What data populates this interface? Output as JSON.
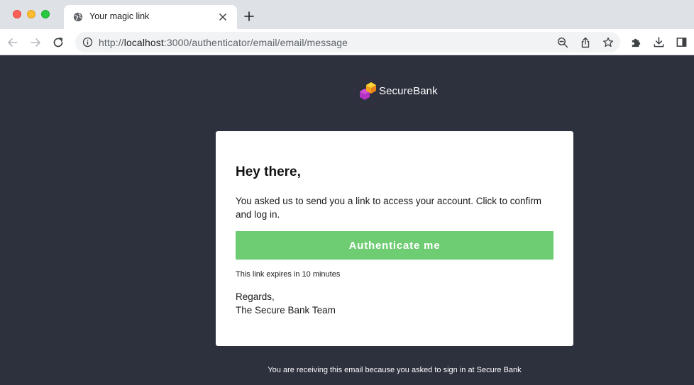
{
  "browser": {
    "tab_title": "Your magic link",
    "url_scheme": "http://",
    "url_host": "localhost",
    "url_path": ":3000/authenticator/email/email/message"
  },
  "icons": {
    "back": "arrow-left-icon",
    "forward": "arrow-right-icon",
    "reload": "reload-icon",
    "info": "info-icon",
    "zoom": "zoom-out-icon",
    "share": "share-icon",
    "bookmark": "star-icon",
    "extensions": "puzzle-icon",
    "download": "download-icon",
    "sidepanel": "side-panel-icon"
  },
  "colors": {
    "page_bg": "#2d303d",
    "button_bg": "#6ecd72",
    "card_bg": "#ffffff"
  },
  "email": {
    "brand": "SecureBank",
    "greeting": "Hey there,",
    "message": "You asked us to send you a link to access your account. Click to confirm and log in.",
    "button_label": "Authenticate me",
    "expiry_note": "This link expires in 10 minutes",
    "regards": "Regards,",
    "signature": "The Secure Bank Team",
    "footer": "You are receiving this email because you asked to sign in at Secure Bank"
  }
}
